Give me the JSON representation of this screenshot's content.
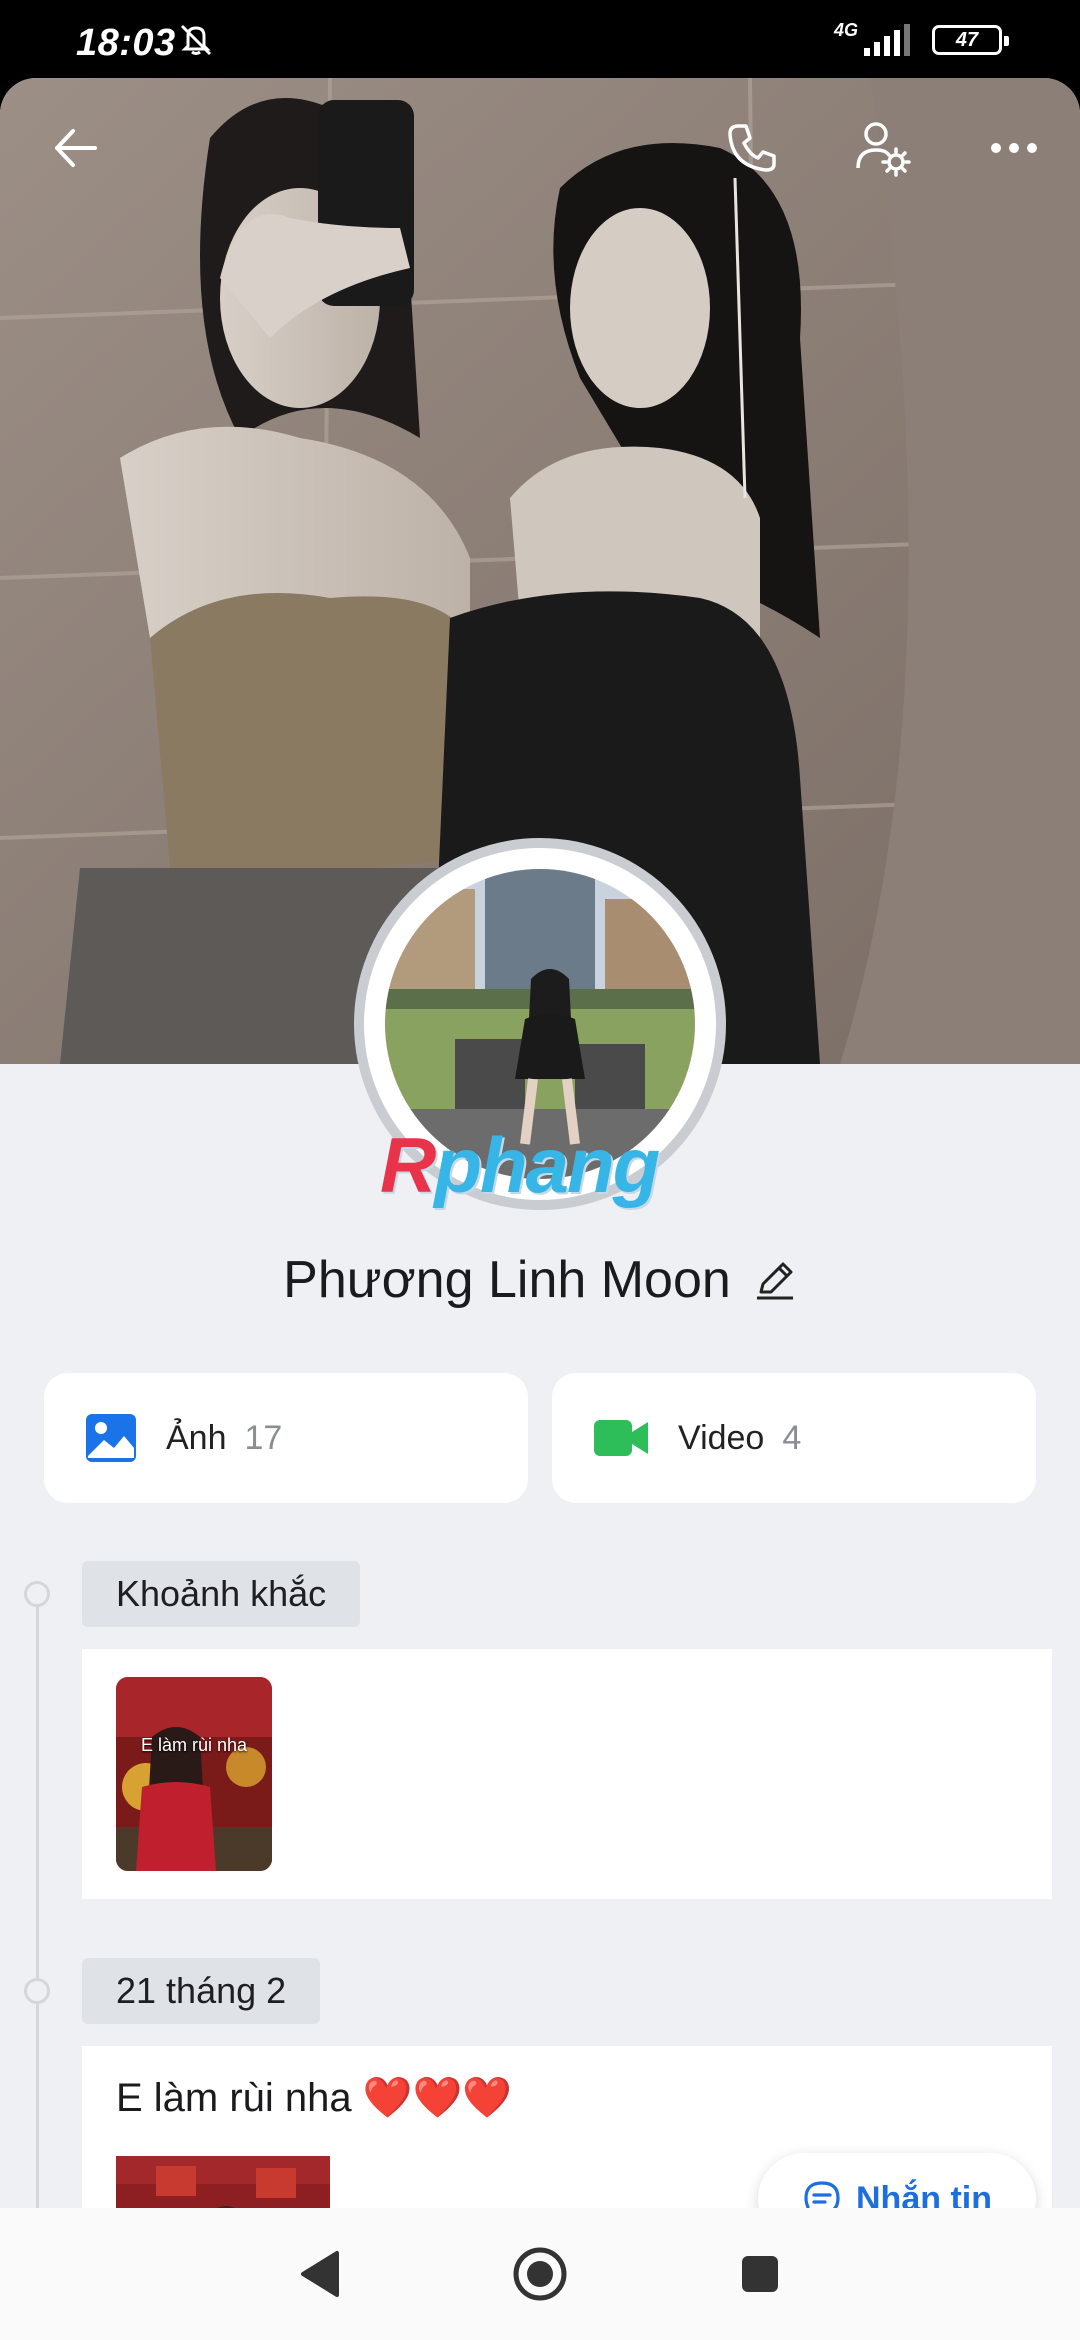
{
  "status_bar": {
    "time": "18:03",
    "network": "4G",
    "battery": "47"
  },
  "header": {
    "back_icon": "arrow-left-icon",
    "call_icon": "phone-icon",
    "settings_icon": "user-settings-icon",
    "more_icon": "more-horizontal-icon"
  },
  "watermark": {
    "first": "R",
    "rest": "phang"
  },
  "profile": {
    "name": "Phương Linh Moon",
    "edit_icon": "pencil-icon"
  },
  "media": {
    "photos_label": "Ảnh",
    "photos_count": "17",
    "videos_label": "Video",
    "videos_count": "4"
  },
  "timeline": {
    "moments_label": "Khoảnh khắc",
    "moment_caption": "E làm rùi nha",
    "date_label": "21 tháng 2",
    "post_text": "E làm rùi nha ❤️❤️❤️"
  },
  "chat_button": {
    "label": "Nhắn tin",
    "icon": "chat-bubble-icon"
  },
  "colors": {
    "accent": "#1d6fe0",
    "photo_icon": "#1a73e8",
    "video_icon": "#2dbe5a",
    "background": "#eef0f3"
  }
}
